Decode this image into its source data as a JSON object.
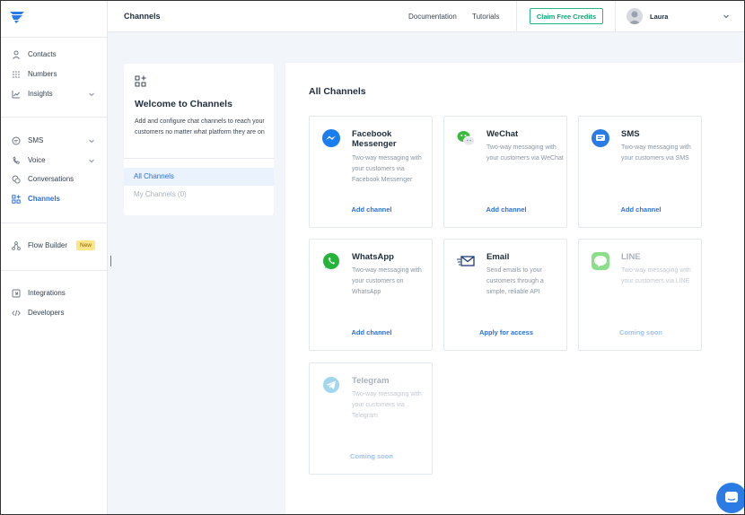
{
  "header": {
    "title": "Channels",
    "documentation": "Documentation",
    "tutorials": "Tutorials",
    "claim": "Claim Free Credits",
    "user": "Laura"
  },
  "sidebar": {
    "items": [
      {
        "label": "Contacts",
        "icon": "person-icon"
      },
      {
        "label": "Numbers",
        "icon": "grid-icon"
      },
      {
        "label": "Insights",
        "icon": "chart-icon"
      },
      {
        "label": "SMS",
        "icon": "sms-icon"
      },
      {
        "label": "Voice",
        "icon": "voice-icon"
      },
      {
        "label": "Conversations",
        "icon": "conversations-icon"
      },
      {
        "label": "Channels",
        "icon": "channels-icon"
      },
      {
        "label": "Flow Builder",
        "icon": "flow-icon"
      },
      {
        "label": "Integrations",
        "icon": "integrations-icon"
      },
      {
        "label": "Developers",
        "icon": "code-icon"
      }
    ],
    "new_badge": "New"
  },
  "welcome": {
    "title": "Welcome to Channels",
    "description": "Add and configure chat channels to reach your customers no matter what platform they are on",
    "tabs": [
      "All Channels",
      "My Channels (0)"
    ]
  },
  "main": {
    "title": "All Channels",
    "channels": [
      {
        "name": "Facebook Messenger",
        "desc": "Two-way messaging with your customers via Facebook Messenger",
        "action": "Add channel"
      },
      {
        "name": "WeChat",
        "desc": "Two-way messaging with your customers via WeChat",
        "action": "Add channel"
      },
      {
        "name": "SMS",
        "desc": "Two-way messaging with your customers via SMS",
        "action": "Add channel"
      },
      {
        "name": "WhatsApp",
        "desc": "Two-way messaging with your customers on WhatsApp",
        "action": "Add channel"
      },
      {
        "name": "Email",
        "desc": "Send emails to your customers through a simple, reliable API",
        "action": "Apply for access"
      },
      {
        "name": "LINE",
        "desc": "Two-way messaging with your customers via LINE",
        "action": "Coming soon"
      },
      {
        "name": "Telegram",
        "desc": "Two-way messaging with your customers via Telegram",
        "action": "Coming soon"
      }
    ]
  },
  "colors": {
    "accent": "#2b6fe0",
    "claim": "#1fb981",
    "badge": "#ffe58a"
  }
}
